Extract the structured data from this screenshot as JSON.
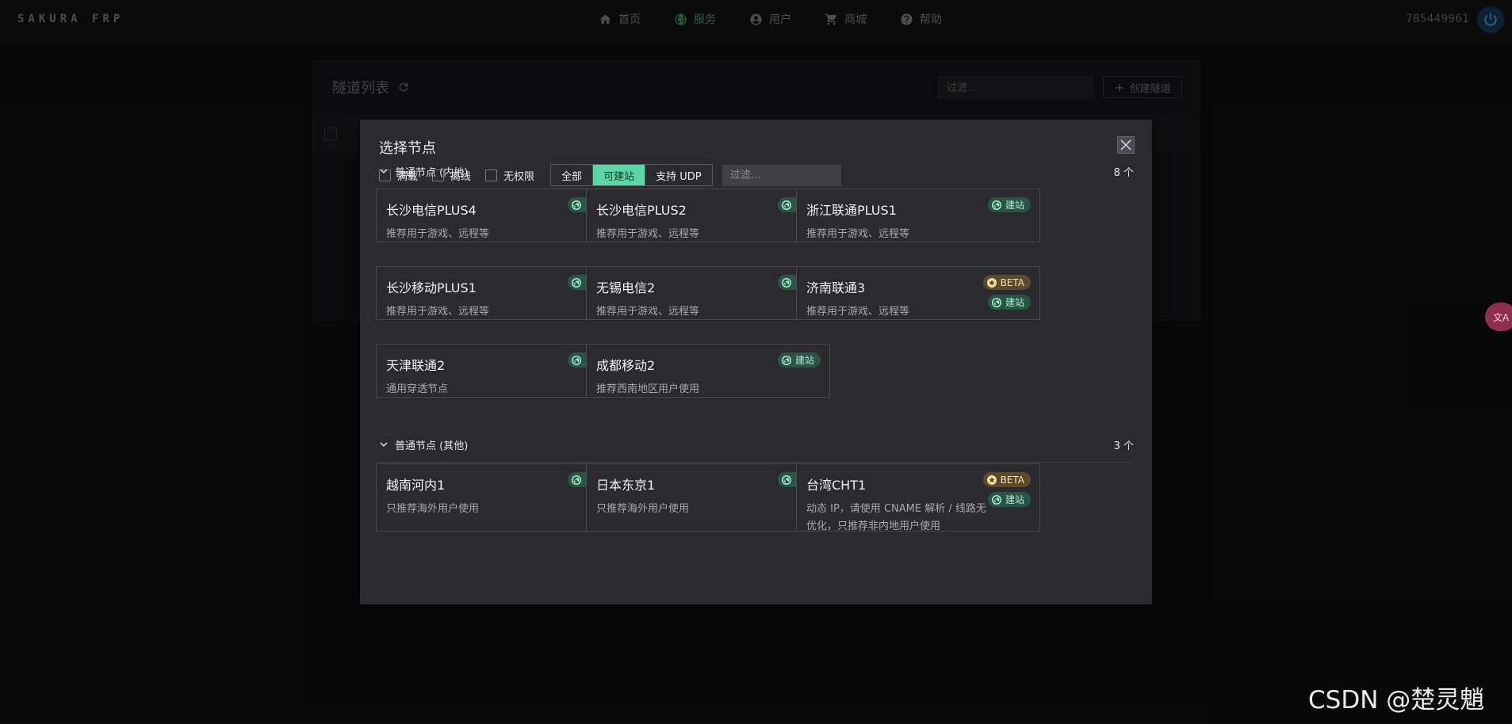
{
  "topbar": {
    "brand": "SAKURA FRP",
    "nav": [
      {
        "label": "首页",
        "icon": "home-icon",
        "active": false
      },
      {
        "label": "服务",
        "icon": "globe-icon",
        "active": true
      },
      {
        "label": "用户",
        "icon": "user-icon",
        "active": false
      },
      {
        "label": "商城",
        "icon": "cart-icon",
        "active": false
      },
      {
        "label": "帮助",
        "icon": "help-icon",
        "active": false
      }
    ],
    "user_id": "785449961"
  },
  "background": {
    "title": "隧道列表",
    "filter_placeholder": "过滤...",
    "create_label": "创建隧道"
  },
  "modal": {
    "title": "选择节点",
    "checkboxes": [
      "满载",
      "离线",
      "无权限"
    ],
    "segments": [
      {
        "label": "全部",
        "active": false
      },
      {
        "label": "可建站",
        "active": true
      },
      {
        "label": "支持 UDP",
        "active": false
      }
    ],
    "filter_placeholder": "过滤...",
    "sections": [
      {
        "title": "普通节点 (内地)",
        "count": "8 个",
        "nodes": [
          {
            "name": "长沙电信PLUS4",
            "desc": "推荐用于游戏、远程等",
            "badges": [
              "建站"
            ]
          },
          {
            "name": "长沙电信PLUS2",
            "desc": "推荐用于游戏、远程等",
            "badges": [
              "建站"
            ]
          },
          {
            "name": "浙江联通PLUS1",
            "desc": "推荐用于游戏、远程等",
            "badges": [
              "建站"
            ]
          },
          {
            "name": "长沙移动PLUS1",
            "desc": "推荐用于游戏、远程等",
            "badges": [
              "建站"
            ]
          },
          {
            "name": "无锡电信2",
            "desc": "推荐用于游戏、远程等",
            "badges": [
              "建站"
            ]
          },
          {
            "name": "济南联通3",
            "desc": "推荐用于游戏、远程等",
            "badges": [
              "BETA",
              "建站"
            ]
          },
          {
            "name": "天津联通2",
            "desc": "通用穿透节点",
            "badges": [
              "建站"
            ]
          },
          {
            "name": "成都移动2",
            "desc": "推荐西南地区用户使用",
            "badges": [
              "建站"
            ]
          }
        ]
      },
      {
        "title": "普通节点 (其他)",
        "count": "3 个",
        "nodes": [
          {
            "name": "越南河内1",
            "desc": "只推荐海外用户使用",
            "badges": [
              "建站"
            ]
          },
          {
            "name": "日本东京1",
            "desc": "只推荐海外用户使用",
            "badges": [
              "建站"
            ]
          },
          {
            "name": "台湾CHT1",
            "desc": "动态 IP，请使用 CNAME 解析 / 线路无优化，只推荐非内地用户使用",
            "badges": [
              "BETA",
              "建站"
            ]
          }
        ]
      }
    ]
  },
  "watermark": "CSDN @楚灵魈",
  "colors": {
    "accent": "#5fd4a6",
    "nav_active": "#4caf7d",
    "site_badge": "#2a5445",
    "beta_badge": "#5c4a2e"
  }
}
